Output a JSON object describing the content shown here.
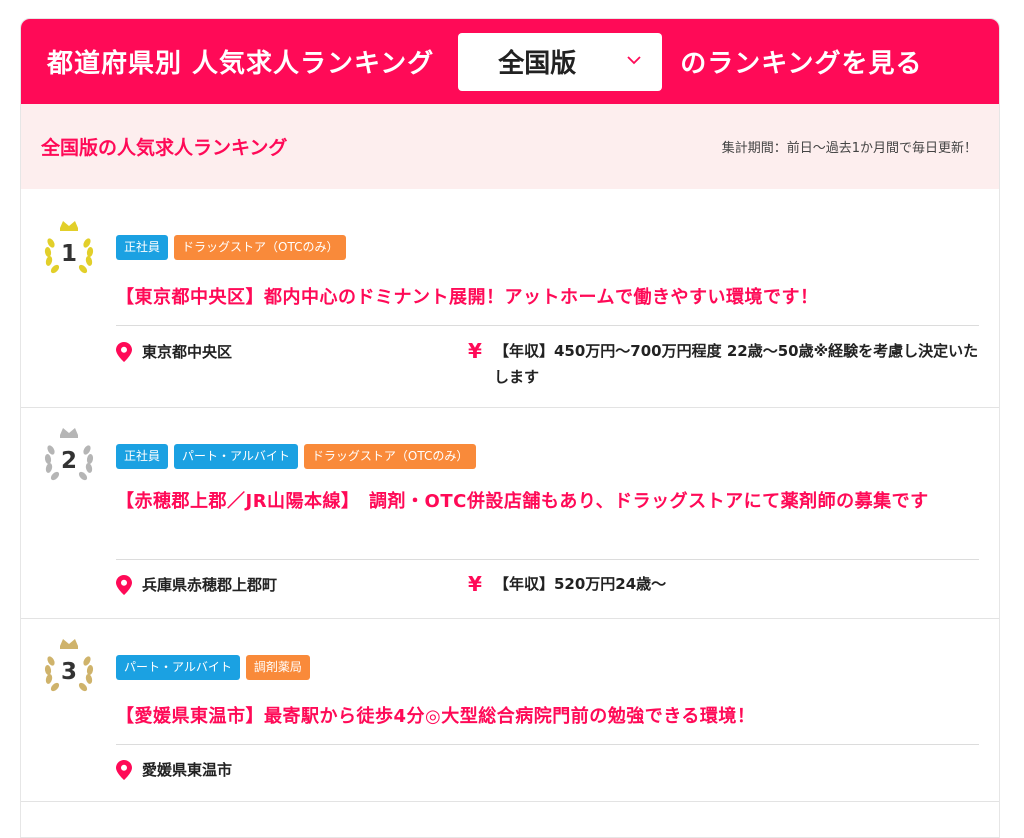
{
  "header": {
    "title": "都道府県別 人気求人ランキング",
    "select_value": "全国版",
    "suffix": "のランキングを見る"
  },
  "subbar": {
    "title": "全国版の人気求人ランキング",
    "period": "集計期間：前日〜過去1か月間で毎日更新！"
  },
  "colors": {
    "brand": "#ff0a57",
    "tag_blue": "#1ba1e2",
    "tag_orange": "#f98a3a",
    "medal_gold": "#e2cf2a",
    "medal_silver": "#b5b5b5",
    "medal_bronze": "#cfb36b"
  },
  "rankings": [
    {
      "rank": "1",
      "medal": "gold-crown-laurel-icon",
      "tags": [
        {
          "label": "正社員",
          "color": "blue"
        },
        {
          "label": "ドラッグストア（OTCのみ）",
          "color": "orange"
        }
      ],
      "title": "【東京都中央区】都内中心のドミナント展開！アットホームで働きやすい環境です！",
      "location": "東京都中央区",
      "salary": "【年収】450万円〜700万円程度 22歳〜50歳※経験を考慮し決定いたします"
    },
    {
      "rank": "2",
      "medal": "silver-crown-laurel-icon",
      "tags": [
        {
          "label": "正社員",
          "color": "blue"
        },
        {
          "label": "パート・アルバイト",
          "color": "blue"
        },
        {
          "label": "ドラッグストア（OTCのみ）",
          "color": "orange"
        }
      ],
      "title": "【赤穂郡上郡／JR山陽本線】　調剤・OTC併設店舗もあり、ドラッグストアにて薬剤師の募集です",
      "location": "兵庫県赤穂郡上郡町",
      "salary": "【年収】520万円24歳〜"
    },
    {
      "rank": "3",
      "medal": "bronze-crown-laurel-icon",
      "tags": [
        {
          "label": "パート・アルバイト",
          "color": "blue"
        },
        {
          "label": "調剤薬局",
          "color": "orange"
        }
      ],
      "title": "【愛媛県東温市】最寄駅から徒歩4分◎大型総合病院門前の勉強できる環境！",
      "location": "愛媛県東温市"
    }
  ]
}
